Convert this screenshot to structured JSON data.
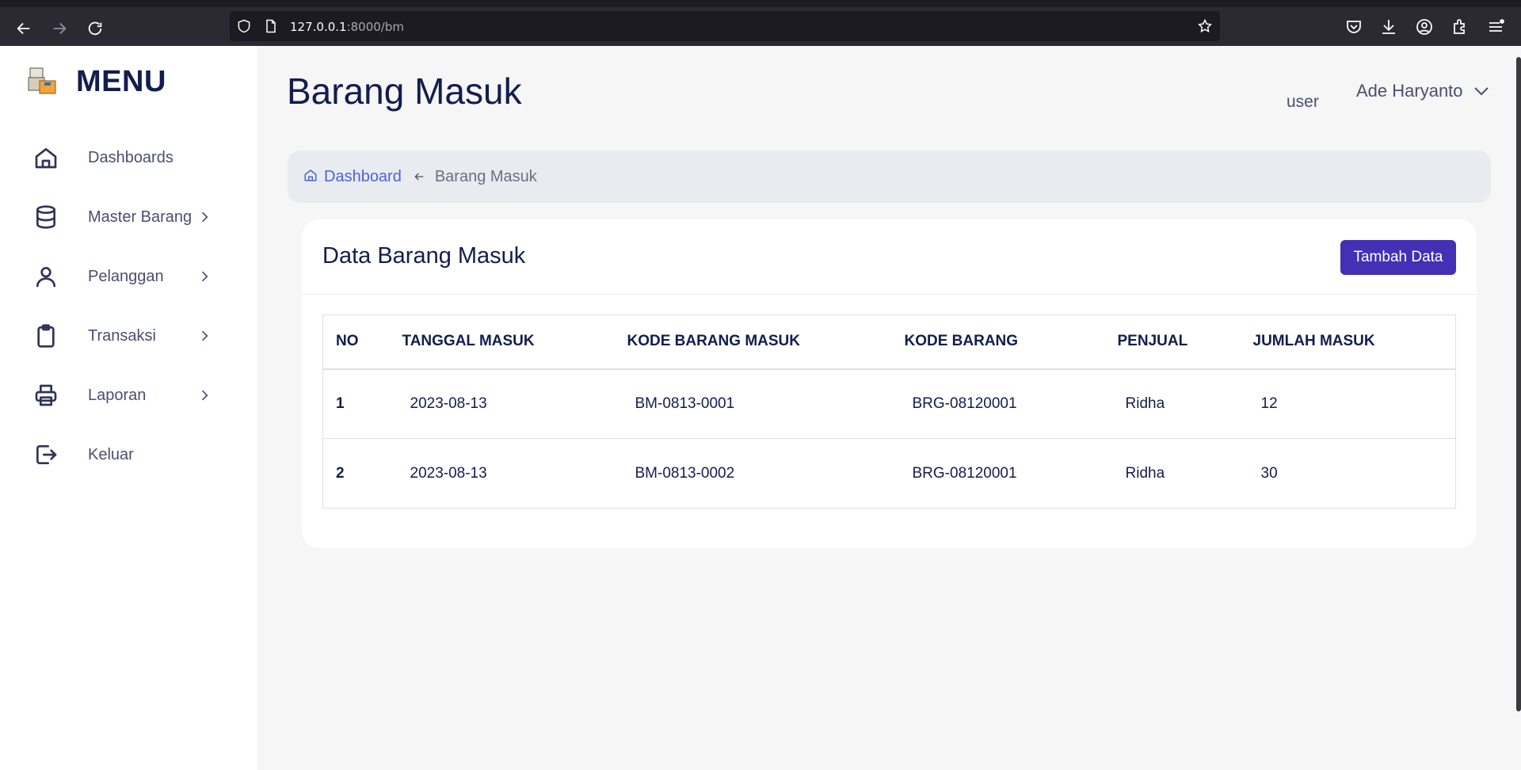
{
  "browser": {
    "url_host": "127.0.0.1",
    "url_path": ":8000/bm"
  },
  "sidebar": {
    "title": "MENU",
    "items": [
      {
        "label": "Dashboards",
        "icon": "home-icon",
        "has_submenu": false
      },
      {
        "label": "Master Barang",
        "icon": "database-icon",
        "has_submenu": true
      },
      {
        "label": "Pelanggan",
        "icon": "user-icon",
        "has_submenu": true
      },
      {
        "label": "Transaksi",
        "icon": "clipboard-icon",
        "has_submenu": true
      },
      {
        "label": "Laporan",
        "icon": "printer-icon",
        "has_submenu": true
      },
      {
        "label": "Keluar",
        "icon": "logout-icon",
        "has_submenu": false
      }
    ]
  },
  "header": {
    "title": "Barang Masuk",
    "role": "user",
    "user_name": "Ade Haryanto"
  },
  "breadcrumb": {
    "home": "Dashboard",
    "current": "Barang Masuk"
  },
  "card": {
    "title": "Data Barang Masuk",
    "add_button": "Tambah Data"
  },
  "table": {
    "headers": [
      "NO",
      "TANGGAL MASUK",
      "KODE BARANG MASUK",
      "KODE BARANG",
      "PENJUAL",
      "JUMLAH MASUK"
    ],
    "rows": [
      [
        "1",
        "2023-08-13",
        "BM-0813-0001",
        "BRG-08120001",
        "Ridha",
        "12"
      ],
      [
        "2",
        "2023-08-13",
        "BM-0813-0002",
        "BRG-08120001",
        "Ridha",
        "30"
      ]
    ]
  },
  "colors": {
    "primary": "#4330b4",
    "link": "#4e63d8",
    "heading": "#131d4e"
  }
}
